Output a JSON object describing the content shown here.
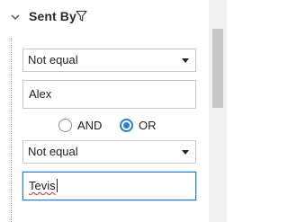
{
  "header": {
    "title": "Sent By",
    "collapse_icon": "chevron-down-icon",
    "filter_icon": "funnel-icon"
  },
  "condition1": {
    "operator": "Not equal",
    "value": "Alex"
  },
  "logic": {
    "and_label": "AND",
    "or_label": "OR",
    "selected": "OR"
  },
  "condition2": {
    "operator": "Not equal",
    "value": "Tevis"
  },
  "colors": {
    "accent": "#2a7fd6",
    "border": "#c9c9c9",
    "spellcheck": "#d32f2f"
  }
}
